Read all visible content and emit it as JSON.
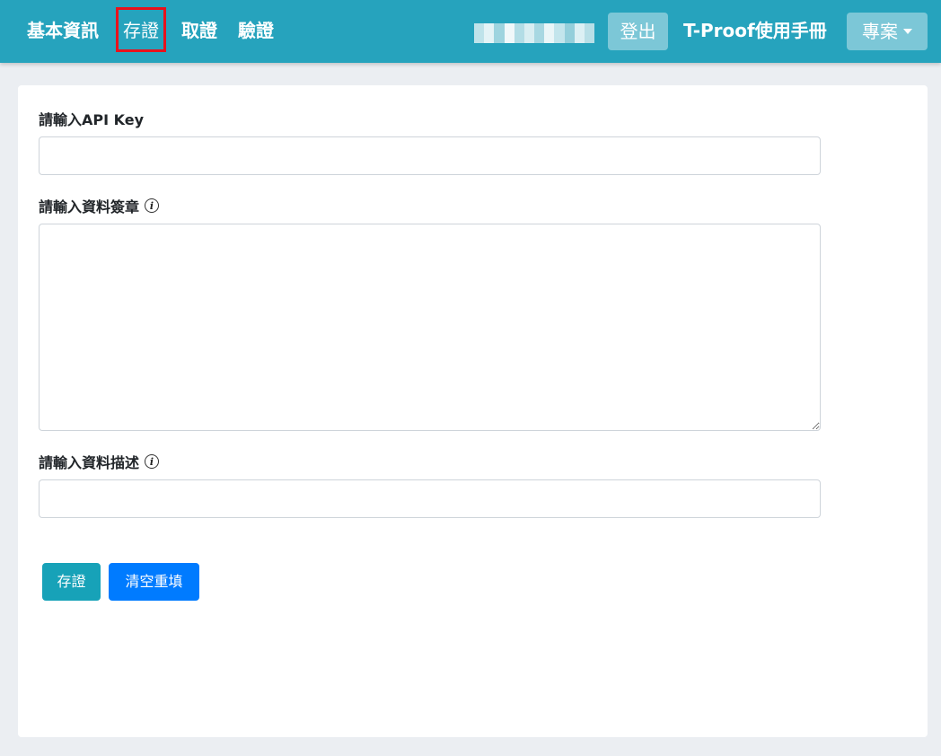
{
  "nav": {
    "items": [
      {
        "label": "基本資訊"
      },
      {
        "label": "存證"
      },
      {
        "label": "取證"
      },
      {
        "label": "驗證"
      }
    ],
    "logout_label": "登出",
    "manual_label": "T-Proof使用手冊",
    "project_label": "專案"
  },
  "form": {
    "api_key_label": "請輸入API Key",
    "api_key_value": "",
    "signature_label": "請輸入資料簽章",
    "signature_value": "",
    "description_label": "請輸入資料描述",
    "description_value": "",
    "info_glyph": "i"
  },
  "actions": {
    "submit_label": "存證",
    "reset_label": "清空重填"
  },
  "colors": {
    "navbar": "#26a3bd",
    "navbar_button": "#7cc7d7",
    "active_outline": "#e8121c",
    "submit_button": "#17a2b8",
    "reset_button": "#007bff",
    "background": "#ebeef2"
  }
}
